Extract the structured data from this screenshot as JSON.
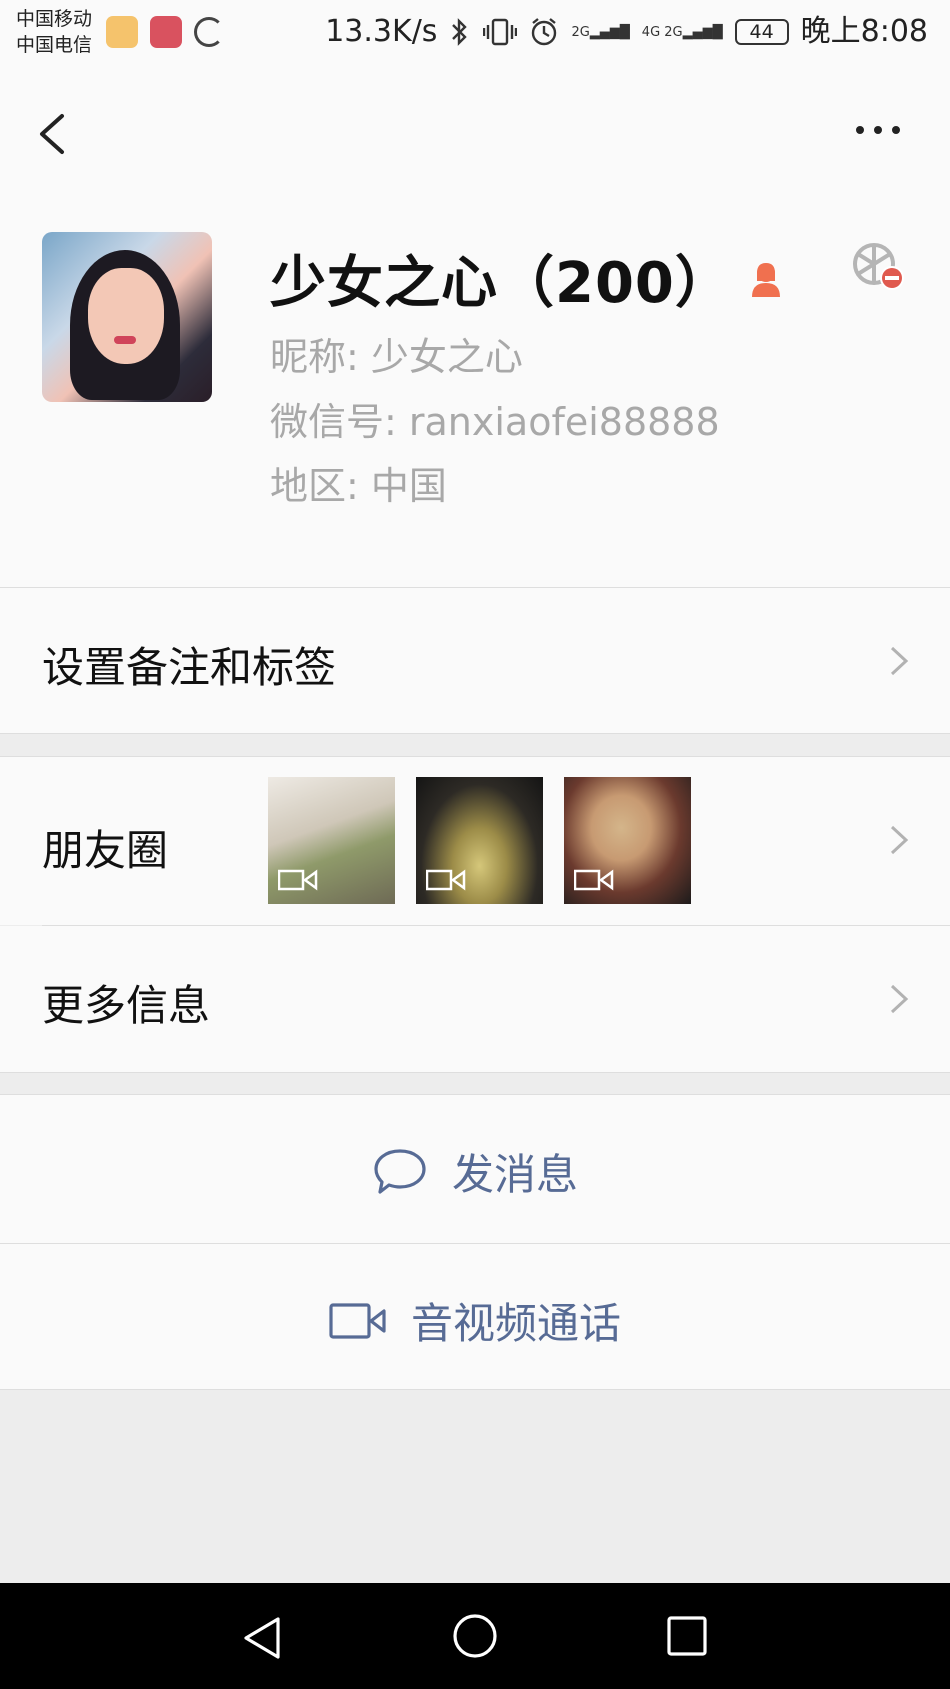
{
  "status_bar": {
    "carrier_1": "中国移动",
    "carrier_2": "中国电信",
    "network_speed": "13.3K/s",
    "signal_1": "2G",
    "signal_2": "4G 2G",
    "battery": "44",
    "time": "晚上8:08"
  },
  "profile": {
    "name": "少女之心（200）",
    "nickname": "昵称:  少女之心",
    "wechat_id": "微信号:  ranxiaofei88888",
    "region": "地区:  中国"
  },
  "menu": {
    "remark_tags": "设置备注和标签",
    "moments": "朋友圈",
    "more_info": "更多信息"
  },
  "actions": {
    "send_message": "发消息",
    "av_call": "音视频通话"
  },
  "colors": {
    "link": "#576b95",
    "gender_female": "#f0704f",
    "background": "#ededed"
  }
}
